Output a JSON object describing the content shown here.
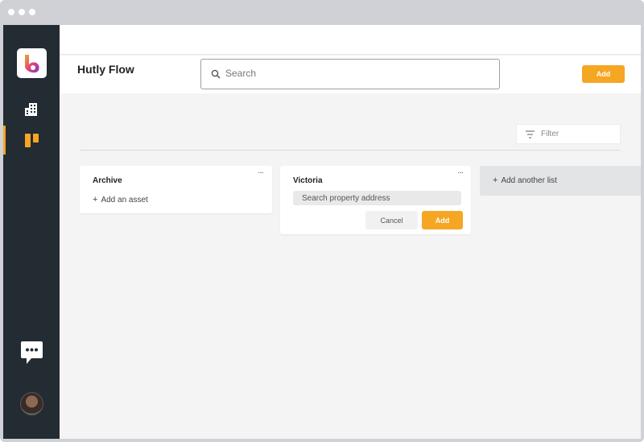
{
  "header": {
    "title": "Hutly Flow",
    "search_placeholder": "Search",
    "add_label": "Add"
  },
  "sidebar": {
    "items": [
      {
        "name": "buildings",
        "icon": "building-icon",
        "active": false
      },
      {
        "name": "board",
        "icon": "board-icon",
        "active": true
      }
    ],
    "chat_icon": "chat-icon",
    "avatar": "user-avatar"
  },
  "filter": {
    "label": "Filter"
  },
  "lists": [
    {
      "title": "Archive",
      "add_asset_label": "Add an asset",
      "more": "···"
    },
    {
      "title": "Victoria",
      "address_placeholder": "Search property address",
      "cancel_label": "Cancel",
      "add_label": "Add",
      "more": "···"
    }
  ],
  "add_another_list_label": "Add another list",
  "colors": {
    "accent": "#f5a623",
    "sidebar": "#232b33",
    "background": "#f4f4f4"
  }
}
